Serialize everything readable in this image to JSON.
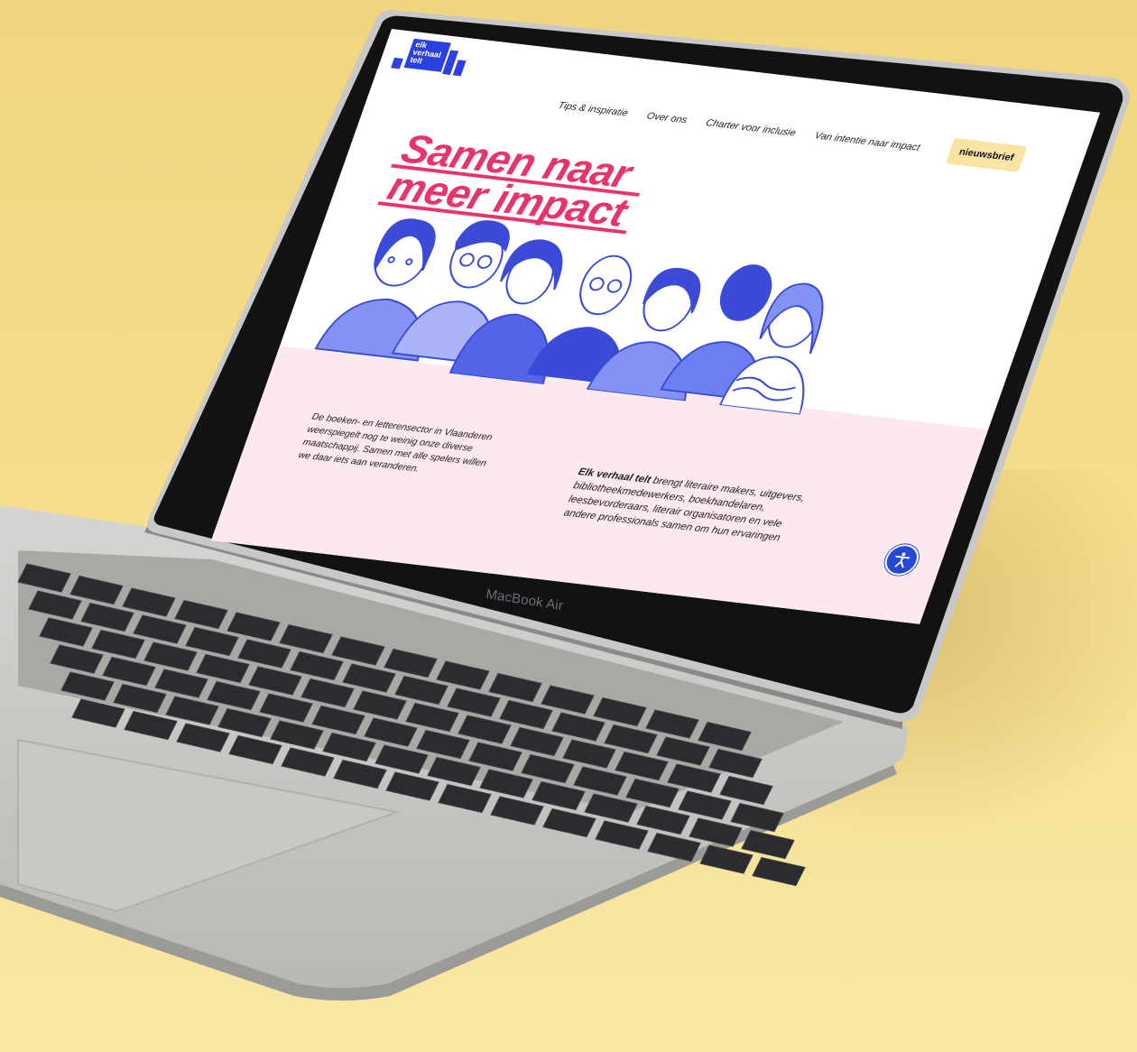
{
  "site": {
    "logo_lines": [
      "elk",
      "verhaal",
      "telt"
    ],
    "nav": {
      "links": [
        "Tips & inspiratie",
        "Over ons",
        "Charter voor inclusie",
        "Van intentie naar impact"
      ],
      "newsletter_label": "nieuwsbrief"
    },
    "hero": {
      "title_line1": "Samen naar",
      "title_line2": "meer impact"
    },
    "intro": {
      "left_text": "De boeken- en letterensector in Vlaanderen weerspiegelt nog te weinig onze diverse maatschappij. Samen met alle spelers willen we daar iets aan veranderen.",
      "right_bold": "Elk verhaal telt",
      "right_text": " brengt literaire makers, uitgevers, bibliotheekmedewerkers, boekhandelaren, leesbevorderaars, literair organisatoren en vele andere professionals samen om hun ervaringen"
    },
    "accessibility_icon": "accessibility-icon"
  },
  "device": {
    "brand_label": "MacBook Air"
  },
  "colors": {
    "background": "#f3d983",
    "accent_pink": "#e8336b",
    "brand_blue": "#2c3fe0",
    "illustration_blue": "#6d7ff0",
    "newsletter_bg": "#f9e4a3",
    "section_pink": "#fce8ef"
  }
}
